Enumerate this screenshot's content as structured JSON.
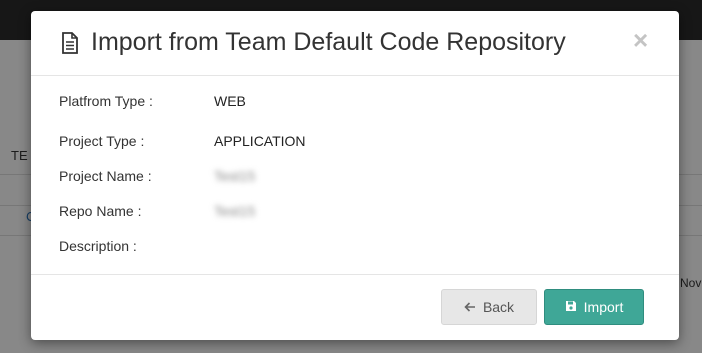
{
  "background": {
    "header_fragment": "TE",
    "link_fragment": "C",
    "date_fragment": "Nov"
  },
  "modal": {
    "title": "Import from Team Default Code Repository",
    "title_icon": "document-icon",
    "close_glyph": "×",
    "fields": [
      {
        "label": "Platfrom Type :",
        "value": "WEB"
      },
      {
        "label": "Project Type :",
        "value": "APPLICATION"
      },
      {
        "label": "Project Name :",
        "value": "Test15"
      },
      {
        "label": "Repo Name :",
        "value": "Test15"
      },
      {
        "label": "Description :",
        "value": ""
      }
    ],
    "buttons": {
      "back_label": "Back",
      "back_icon": "arrow-left-icon",
      "import_label": "Import",
      "import_icon": "save-icon"
    }
  },
  "colors": {
    "primary_button": "#3fa797",
    "secondary_button": "#e7e7e7",
    "overlay": "rgba(0,0,0,0.45)"
  }
}
